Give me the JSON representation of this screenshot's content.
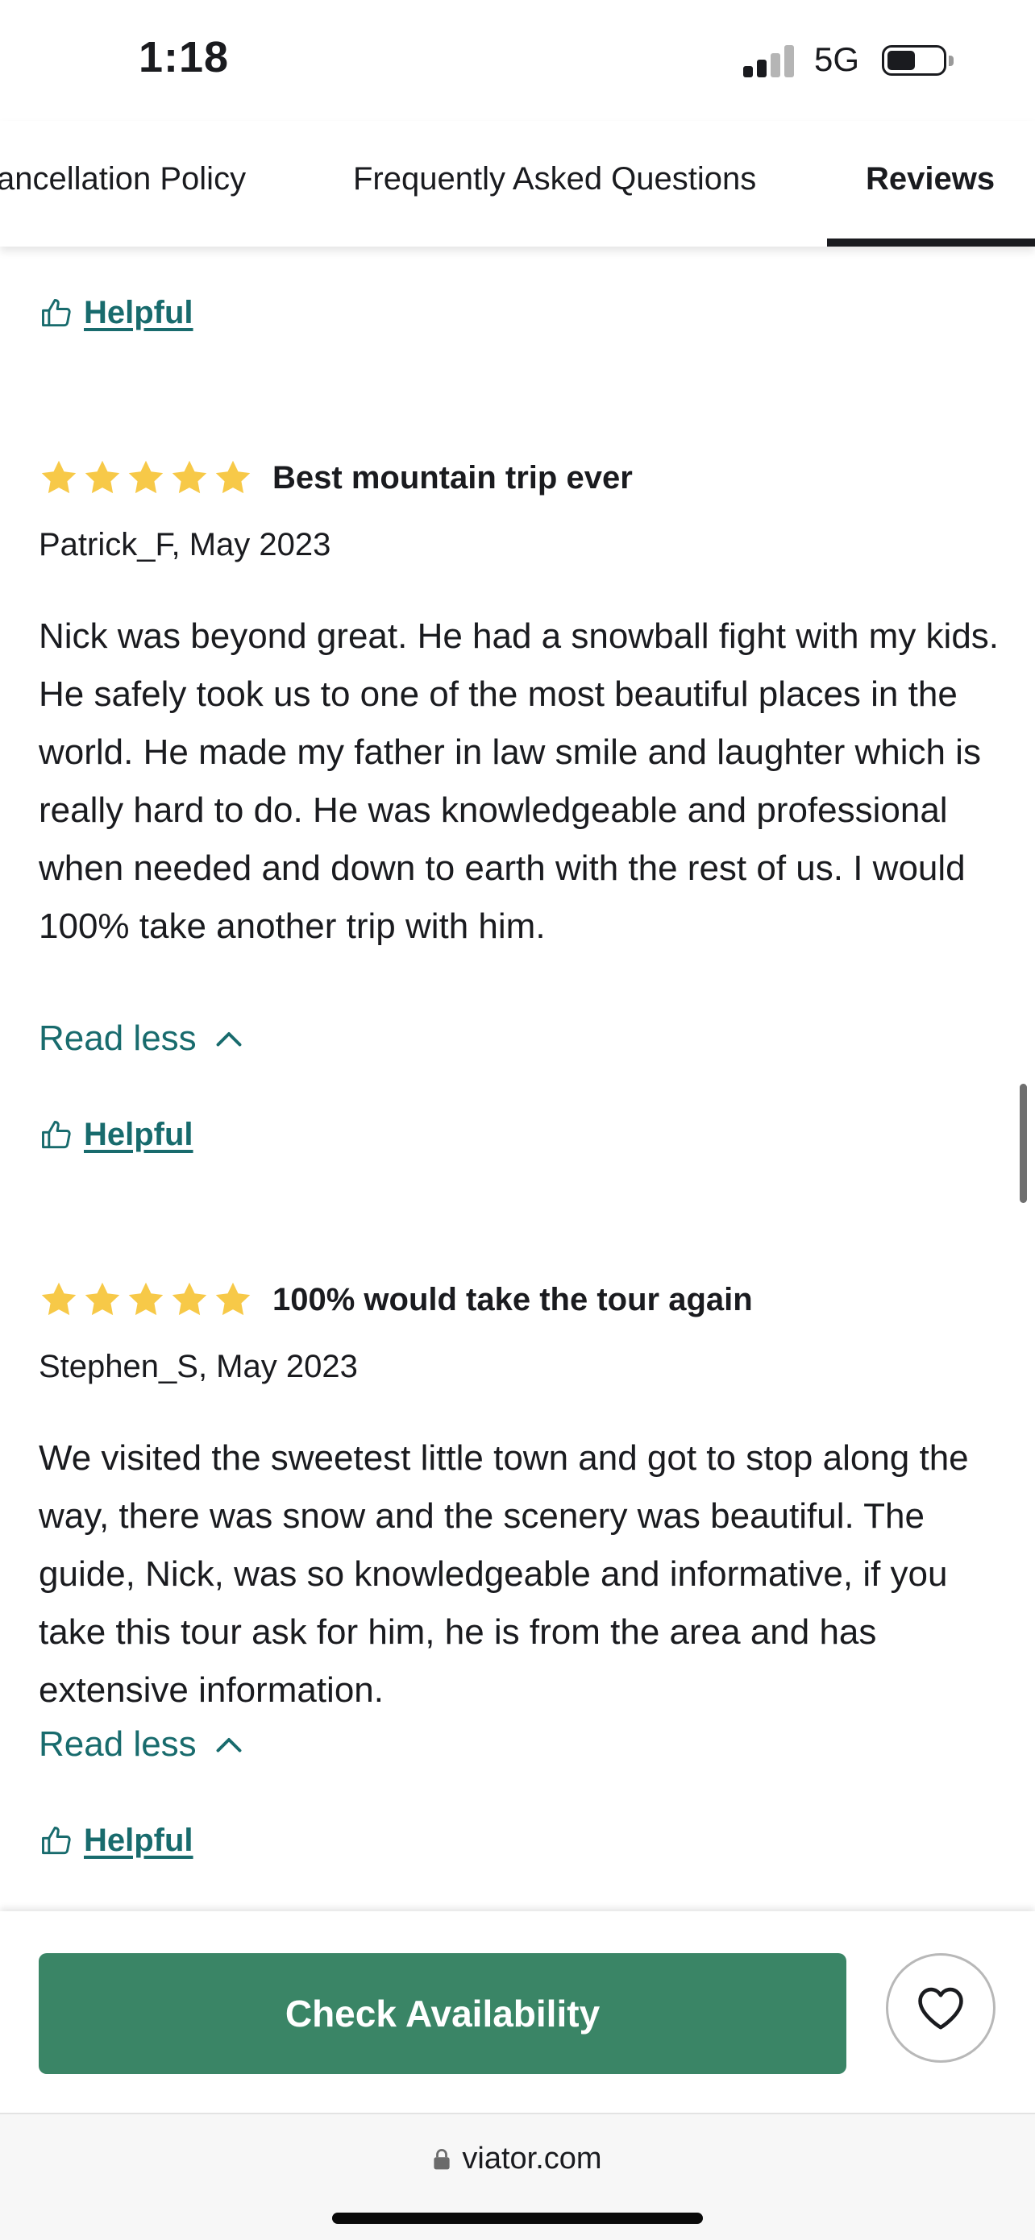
{
  "status_bar": {
    "time": "1:18",
    "network": "5G"
  },
  "tabs": [
    {
      "label": "ancellation Policy",
      "active": false
    },
    {
      "label": "Frequently Asked Questions",
      "active": false
    },
    {
      "label": "Reviews",
      "active": true
    }
  ],
  "helpful_label": "Helpful",
  "read_less_label": "Read less",
  "reviews": [
    {
      "rating": 5,
      "title": "Best mountain trip ever",
      "author": "Patrick_F, May 2023",
      "body": "Nick was beyond great. He had a snowball fight with my kids. He safely took us to one of the most beautiful places in the world. He made my father in law smile and laughter which is really hard to do. He was knowledgeable and professional when needed and down to earth with the rest of us. I would 100% take another trip with him."
    },
    {
      "rating": 5,
      "title": "100% would take the tour again",
      "author": "Stephen_S, May 2023",
      "body": "We visited the sweetest little town and got to stop along the way, there was snow and the scenery was beautiful. The guide, Nick, was so knowledgeable and informative, if you take this tour ask for him, he is from the area and has extensive information."
    }
  ],
  "cta": {
    "check_availability": "Check Availability"
  },
  "browser": {
    "url": "viator.com"
  },
  "colors": {
    "accent_green": "#3a8566",
    "link_green": "#186b6d",
    "star": "#f7c948"
  },
  "icons": [
    "thumbs-up-icon",
    "star-icon",
    "chevron-up-icon",
    "heart-icon",
    "lock-icon"
  ]
}
